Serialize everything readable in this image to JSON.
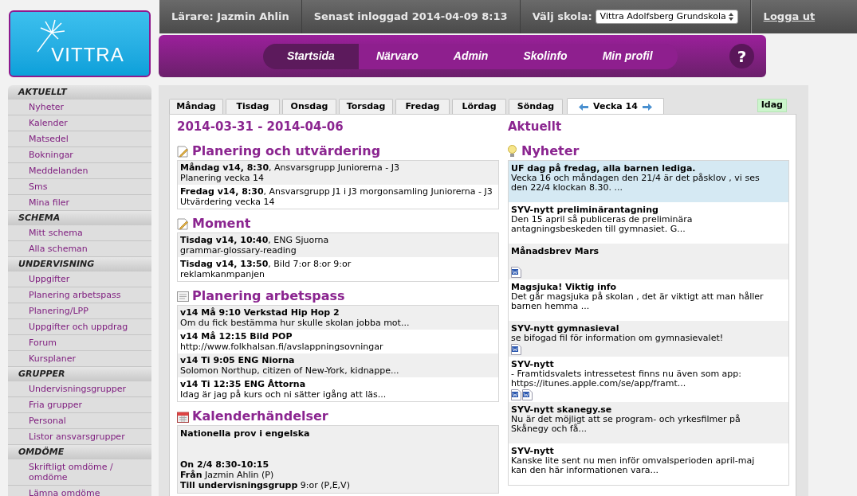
{
  "top_bar": {
    "teacher": "Lärare: Jazmin Ahlin",
    "last_login": "Senast inloggad 2014-04-09 8:13",
    "school_label": "Välj skola:",
    "school_value": "Vittra Adolfsberg Grundskola",
    "logout": "Logga ut"
  },
  "logo": {
    "text": "VITTRA"
  },
  "nav": {
    "items": [
      {
        "label": "Startsida",
        "selected": true
      },
      {
        "label": "Närvaro",
        "selected": false
      },
      {
        "label": "Admin",
        "selected": false
      },
      {
        "label": "Skolinfo",
        "selected": false
      },
      {
        "label": "Min profil",
        "selected": false
      }
    ],
    "help": "?"
  },
  "sidebar": {
    "sections": [
      {
        "heading": "AKTUELLT",
        "items": [
          "Nyheter",
          "Kalender",
          "Matsedel",
          "Bokningar",
          "Meddelanden",
          "Sms",
          "Mina filer"
        ]
      },
      {
        "heading": "SCHEMA",
        "items": [
          "Mitt schema",
          "Alla scheman"
        ]
      },
      {
        "heading": "UNDERVISNING",
        "items": [
          "Uppgifter",
          "Planering arbetspass",
          "Planering/LPP",
          "Uppgifter och uppdrag",
          "Forum",
          "Kursplaner"
        ]
      },
      {
        "heading": "GRUPPER",
        "items": [
          "Undervisningsgrupper",
          "Fria grupper",
          "Personal",
          "Listor ansvarsgrupper"
        ]
      },
      {
        "heading": "OMDÖME",
        "items": [
          "Skriftligt omdöme / omdöme",
          "Lämna omdöme"
        ]
      }
    ]
  },
  "tabs": [
    {
      "kind": "day",
      "label": "Måndag",
      "selected": false
    },
    {
      "kind": "day",
      "label": "Tisdag",
      "selected": false
    },
    {
      "kind": "day",
      "label": "Onsdag",
      "selected": false
    },
    {
      "kind": "day",
      "label": "Torsdag",
      "selected": false
    },
    {
      "kind": "day",
      "label": "Fredag",
      "selected": false
    },
    {
      "kind": "day",
      "label": "Lördag",
      "selected": false
    },
    {
      "kind": "day",
      "label": "Söndag",
      "selected": false
    },
    {
      "kind": "week",
      "label": "Vecka 14",
      "selected": true
    }
  ],
  "today_button": "Idag",
  "date_range": "2014-03-31 - 2014-04-06",
  "sections": [
    {
      "kind": "note",
      "title": "Planering och utvärdering",
      "entries": [
        {
          "line1": "**Måndag v14, 8:30**, Ansvarsgrupp Juniorerna - J3",
          "line2": "Planering vecka 14"
        },
        {
          "line1": "**Fredag v14, 8:30**, Ansvarsgrupp J1 i J3 morgonsamling Juniorerna - J3",
          "line2": "Utvärdering vecka 14"
        }
      ]
    },
    {
      "kind": "note",
      "title": "Moment",
      "entries": [
        {
          "line1": "**Tisdag v14, 10:40**, ENG Sjuorna",
          "line2": "grammar-glossary-reading"
        },
        {
          "line1": "**Tisdag v14, 13:50**, Bild 7:or 8:or 9:or",
          "line2": "reklamkanmpanjen"
        }
      ]
    },
    {
      "kind": "document",
      "title": "Planering arbetspass",
      "entries": [
        {
          "line1": "**v14 Må 9:10 Verkstad Hip Hop 2**",
          "line2": "Om du fick bestämma hur skulle skolan jobba mot..."
        },
        {
          "line1": "**v14 Må 12:15 Bild POP**",
          "line2": "http://www.folkhalsan.fi/avslappningsovningar"
        },
        {
          "line1": "**v14 Ti 9:05 ENG Niorna**",
          "line2": "Solomon Northup, citizen of New-York, kidnappe..."
        },
        {
          "line1": "**v14 Ti 12:35 ENG Åttorna**",
          "line2": "Idag är jag på kurs och ni sätter igång att läs..."
        }
      ]
    },
    {
      "kind": "calendar",
      "title": "Kalenderhändelser",
      "event": {
        "title": "Nationella prov i engelska",
        "time": "On 2/4 8:30-10:15",
        "from": "**Från** Jazmin Ahlin (P)",
        "to": "**Till undervisningsgrupp** 9:or (P,E,V)"
      }
    }
  ],
  "aktuellt": {
    "heading": "Aktuellt",
    "news_heading": "Nyheter",
    "news": [
      {
        "title": "UF dag på fredag, alla barnen lediga.",
        "body": "Vecka 16 och måndagen den 21/4 är det påsklov , vi ses den 22/4 klockan 8.30. ...",
        "highlighted": true
      },
      {
        "title": "SYV-nytt preliminärantagning",
        "body": "Den 15 april så publiceras de preliminära antagningsbeskeden till gymnasiet. G...",
        "highlighted": false
      },
      {
        "title": "Månadsbrev Mars",
        "highlighted": false,
        "attachments": [
          {
            "kind": "word"
          }
        ]
      },
      {
        "title": "Magsjuka! Viktig info",
        "body": "Det går magsjuka på skolan , det är viktigt att man håller barnen hemma ...",
        "highlighted": false
      },
      {
        "title": "SYV-nytt gymnasieval",
        "body": "se bifogad fil för information om gymnasievalet!",
        "highlighted": false,
        "attachments": [
          {
            "kind": "word"
          }
        ]
      },
      {
        "title": "SYV-nytt",
        "body": "- Framtidsvalets intressetest finns nu även som app: https://itunes.apple.com/se/app/framt...",
        "highlighted": false,
        "attachments": [
          {
            "kind": "word"
          },
          {
            "kind": "word"
          }
        ]
      },
      {
        "title": "SYV-nytt skanegy.se",
        "body": "Nu är det möjligt att se program- och yrkesfilmer på Skånegy och få...",
        "highlighted": false
      },
      {
        "title": "SYV-nytt",
        "body": "Kanske lite sent nu men inför omvalsperioden april-maj kan den här informationen vara...",
        "highlighted": false
      }
    ]
  }
}
